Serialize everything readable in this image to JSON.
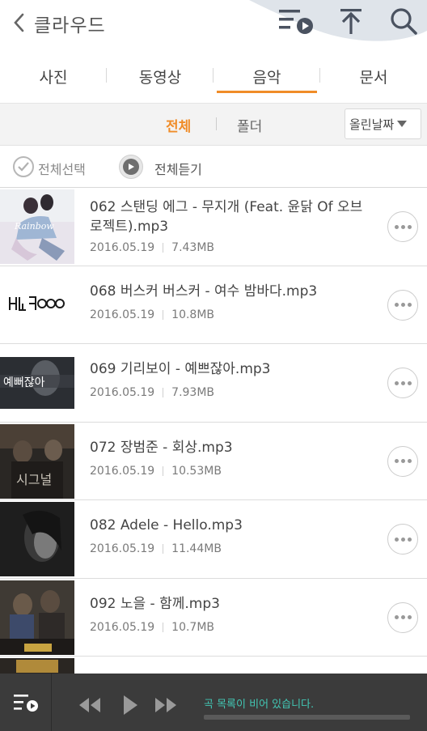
{
  "header": {
    "title": "클라우드",
    "icons": [
      "back-icon",
      "playlist-icon",
      "upload-icon",
      "search-icon"
    ]
  },
  "tabs": [
    {
      "label": "사진",
      "active": false
    },
    {
      "label": "동영상",
      "active": false
    },
    {
      "label": "음악",
      "active": true
    },
    {
      "label": "문서",
      "active": false
    }
  ],
  "filter": {
    "all_label": "전체",
    "folder_label": "폴더",
    "sort_label": "올린날짜"
  },
  "selection": {
    "select_all_label": "전체선택",
    "play_all_label": "전체듣기"
  },
  "tracks": [
    {
      "name": "062 스탠딩 에그 - 무지개 (Feat. 윤닭 Of 오브로젝트).mp3",
      "date": "2016.05.19",
      "size": "7.43MB"
    },
    {
      "name": "068 버스커 버스커 - 여수 밤바다.mp3",
      "date": "2016.05.19",
      "size": "10.8MB"
    },
    {
      "name": "069 기리보이 - 예쁘잖아.mp3",
      "date": "2016.05.19",
      "size": "7.93MB"
    },
    {
      "name": "072 장범준 - 회상.mp3",
      "date": "2016.05.19",
      "size": "10.53MB"
    },
    {
      "name": "082 Adele - Hello.mp3",
      "date": "2016.05.19",
      "size": "11.44MB"
    },
    {
      "name": "092 노을 - 함께.mp3",
      "date": "2016.05.19",
      "size": "10.7MB"
    }
  ],
  "player": {
    "status": "곡 목록이 비어 있습니다.",
    "progress": 0
  },
  "colors": {
    "accent": "#f08c28",
    "player_bg": "#3b3b3b",
    "status_text": "#42c7b4"
  }
}
